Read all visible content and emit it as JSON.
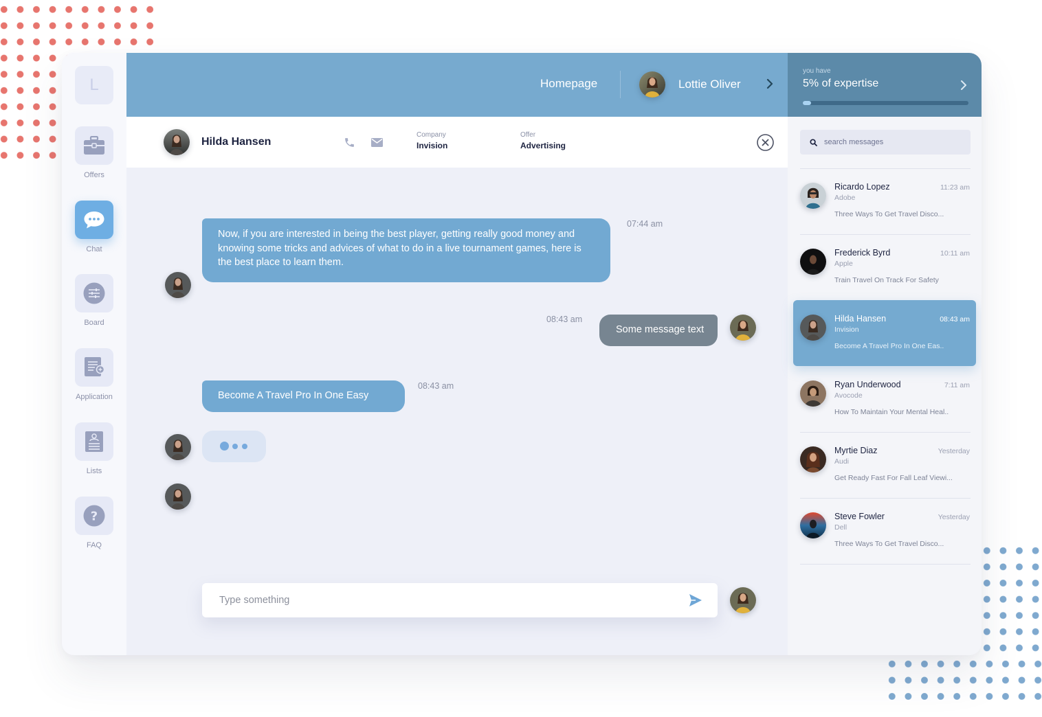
{
  "sidebar": {
    "logo": "L",
    "items": [
      {
        "label": "Offers",
        "icon": "briefcase-icon"
      },
      {
        "label": "Chat",
        "icon": "chat-bubble-icon",
        "active": true
      },
      {
        "label": "Board",
        "icon": "sliders-icon"
      },
      {
        "label": "Application",
        "icon": "document-add-icon"
      },
      {
        "label": "Lists",
        "icon": "id-card-icon"
      },
      {
        "label": "FAQ",
        "icon": "question-icon"
      }
    ]
  },
  "header": {
    "home_label": "Homepage",
    "user_name": "Lottie Oliver",
    "expertise": {
      "small_label": "you have",
      "label": "5% of expertise",
      "progress": 0.05
    }
  },
  "contact": {
    "name": "Hilda Hansen",
    "company_label": "Company",
    "company": "Invision",
    "offer_label": "Offer",
    "offer": "Advertising"
  },
  "messages": [
    {
      "direction": "in",
      "text": "Now, if you are interested in being the best player, getting really good money and knowing some tricks and advices of what to do in a live tournament games, here is the best place to learn them.",
      "time": "07:44 am"
    },
    {
      "direction": "out",
      "text": "Some message text",
      "time": "08:43 am"
    },
    {
      "direction": "in",
      "text": "Become A Travel Pro In One Easy",
      "time": "08:43 am"
    }
  ],
  "composer": {
    "placeholder": "Type something"
  },
  "search": {
    "placeholder": "search messages"
  },
  "conversations": [
    {
      "name": "Ricardo Lopez",
      "company": "Adobe",
      "preview": "Three Ways To Get Travel Disco...",
      "time": "11:23 am"
    },
    {
      "name": "Frederick Byrd",
      "company": "Apple",
      "preview": "Train Travel On Track For Safety",
      "time": "10:11 am"
    },
    {
      "name": "Hilda Hansen",
      "company": "Invision",
      "preview": "Become A Travel Pro In One Eas..",
      "time": "08:43 am",
      "active": true
    },
    {
      "name": "Ryan Underwood",
      "company": "Avocode",
      "preview": "How To Maintain Your Mental Heal..",
      "time": "7:11 am"
    },
    {
      "name": "Myrtie Diaz",
      "company": "Audi",
      "preview": "Get Ready Fast For Fall Leaf Viewi...",
      "time": "Yesterday"
    },
    {
      "name": "Steve Fowler",
      "company": "Dell",
      "preview": "Three Ways To Get Travel Disco...",
      "time": "Yesterday"
    }
  ],
  "colors": {
    "accent": "#77aacf",
    "expertise_bg": "#5c8aa9",
    "outgoing_bubble": "#778591",
    "incoming_bubble": "#72a9d2",
    "decor_red": "#e7756e",
    "decor_blue": "#7fa9cf"
  }
}
